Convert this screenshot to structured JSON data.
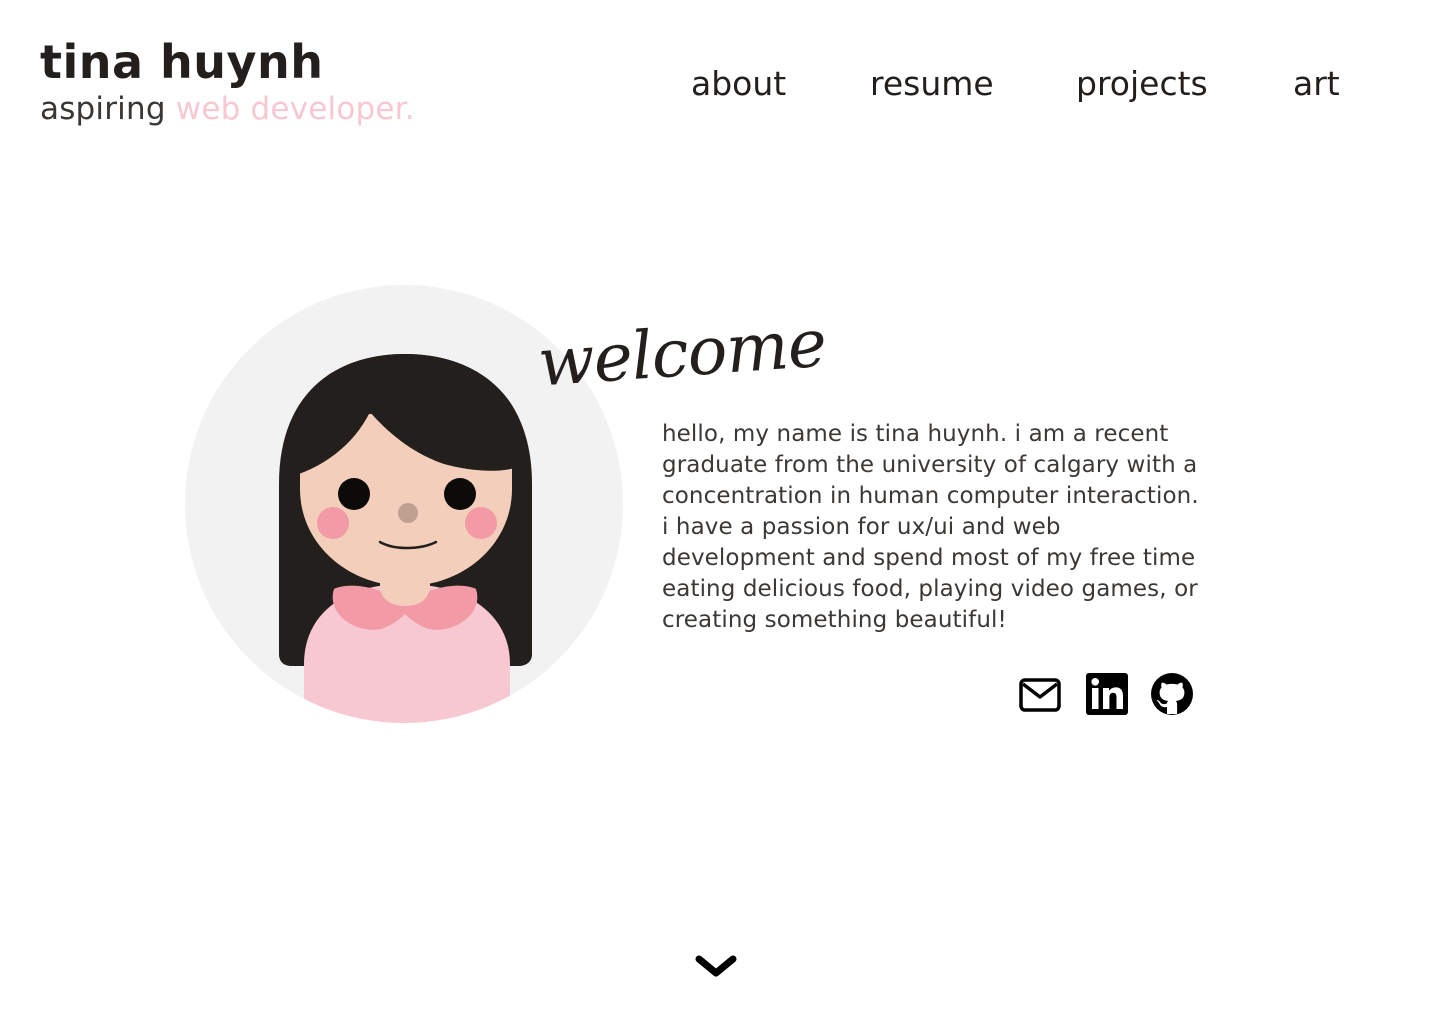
{
  "header": {
    "name": "tina huynh",
    "tagline_prefix": "aspiring",
    "tagline_accent": "web developer."
  },
  "nav": {
    "items": [
      {
        "label": "about"
      },
      {
        "label": "resume"
      },
      {
        "label": "projects"
      },
      {
        "label": "art"
      }
    ]
  },
  "hero": {
    "welcome_text": "welcome",
    "bio": "hello, my name is tina huynh. i am a recent graduate from the university of calgary with a concentration in human computer interaction. i have a passion for ux/ui and web development and spend most of my free time eating delicious food, playing video games, or creating something beautiful!"
  },
  "social": {
    "icons": [
      "envelope-icon",
      "linkedin-icon",
      "github-icon"
    ]
  },
  "colors": {
    "accent_pink": "#f7c8d2",
    "text_dark": "#231f1c",
    "avatar_bg": "#f2f2f2",
    "hair": "#231f1c",
    "skin": "#f3cfbb",
    "cheek": "#f29aa5",
    "shirt": "#f7c8d2",
    "collar": "#f29aa5"
  },
  "scroll_icon": "chevron-down-icon"
}
